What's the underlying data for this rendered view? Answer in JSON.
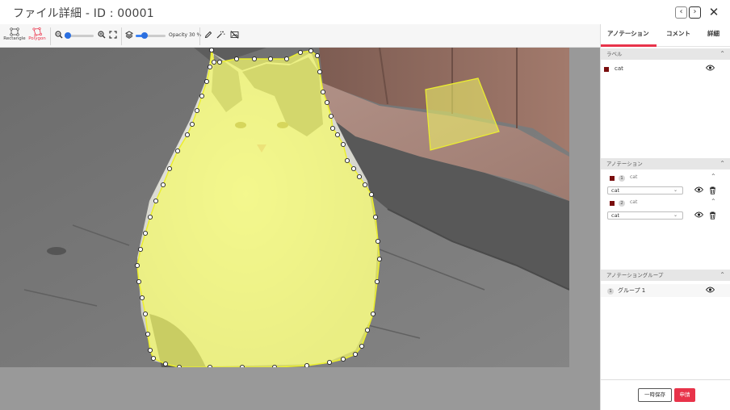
{
  "header": {
    "title": "ファイル詳細 - ID : 00001",
    "prev_icon": "chevron-left-icon",
    "next_icon": "chevron-right-icon",
    "close_icon": "close-icon"
  },
  "toolbar": {
    "rectangle_label": "Rectangle",
    "polygon_label": "Polygon",
    "active_tool": "Polygon",
    "zoom_value": 0.05,
    "opacity_label": "Opacity 30 %",
    "opacity_value": 0.3,
    "accent_color": "#e8334a",
    "slider_color": "#3b82f6"
  },
  "tabs": [
    {
      "label": "アノテーション",
      "active": true
    },
    {
      "label": "コメント",
      "active": false
    },
    {
      "label": "詳細",
      "active": false
    }
  ],
  "labels_section": {
    "title": "ラベル",
    "items": [
      {
        "name": "cat",
        "color": "#7a0e0e"
      }
    ]
  },
  "annotations_section": {
    "title": "アノテーション",
    "items": [
      {
        "index": "1",
        "label": "cat",
        "selected": "cat"
      },
      {
        "index": "2",
        "label": "cat",
        "selected": "cat"
      }
    ]
  },
  "groups_section": {
    "title": "アノテーショングループ",
    "items": [
      {
        "index": "1",
        "name": "グループ 1"
      }
    ]
  },
  "footer": {
    "save_draft_label": "一時保存",
    "submit_label": "申請"
  },
  "canvas": {
    "annotation_fill": "#f4f96a",
    "annotation_stroke": "#ecef2d"
  }
}
